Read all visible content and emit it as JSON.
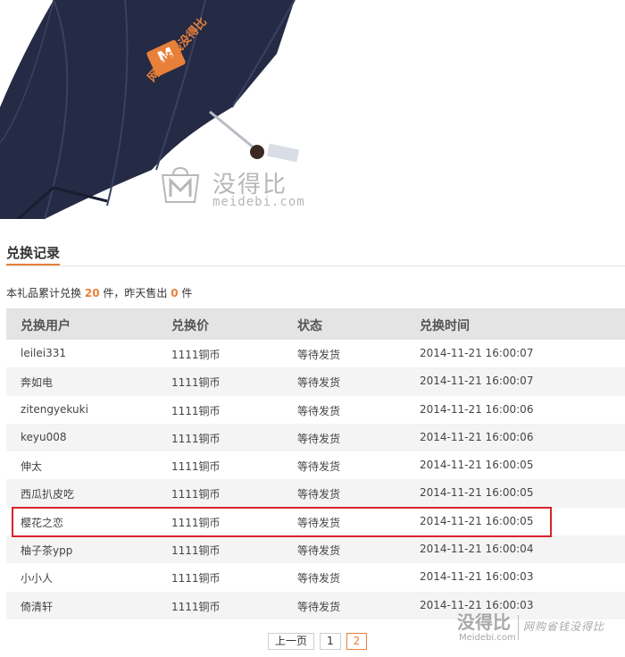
{
  "product": {
    "logo_letter": "M",
    "slogan": "网购省钱没得比",
    "watermark_cn": "没得比",
    "watermark_en": "meidebi.com"
  },
  "section": {
    "title": "兑换记录"
  },
  "summary": {
    "prefix": "本礼品累计兑换",
    "total": "20",
    "mid": "件，昨天售出",
    "yesterday": "0",
    "suffix": "件"
  },
  "table": {
    "headers": [
      "兑换用户",
      "兑换价",
      "状态",
      "兑换时间"
    ],
    "rows": [
      [
        "leilei331",
        "1111铜币",
        "等待发货",
        "2014-11-21 16:00:07"
      ],
      [
        "奔如电",
        "1111铜币",
        "等待发货",
        "2014-11-21 16:00:07"
      ],
      [
        "zitengyekuki",
        "1111铜币",
        "等待发货",
        "2014-11-21 16:00:06"
      ],
      [
        "keyu008",
        "1111铜币",
        "等待发货",
        "2014-11-21 16:00:06"
      ],
      [
        "伸太",
        "1111铜币",
        "等待发货",
        "2014-11-21 16:00:05"
      ],
      [
        "西瓜扒皮吃",
        "1111铜币",
        "等待发货",
        "2014-11-21 16:00:05"
      ],
      [
        "樱花之恋",
        "1111铜币",
        "等待发货",
        "2014-11-21 16:00:05"
      ],
      [
        "柚子茶ypp",
        "1111铜币",
        "等待发货",
        "2014-11-21 16:00:04"
      ],
      [
        "小小人",
        "1111铜币",
        "等待发货",
        "2014-11-21 16:00:03"
      ],
      [
        "倚清轩",
        "1111铜币",
        "等待发货",
        "2014-11-21 16:00:03"
      ]
    ]
  },
  "pager": {
    "prev": "上一页",
    "pages": [
      "1",
      "2"
    ],
    "current": "2"
  },
  "watermark": {
    "cn": "没得比",
    "en": "Meidebi.com",
    "slogan": "网购省钱没得比"
  },
  "colors": {
    "accent": "#e8803a",
    "highlight": "#d9222a",
    "umbrella": "#252a45"
  }
}
